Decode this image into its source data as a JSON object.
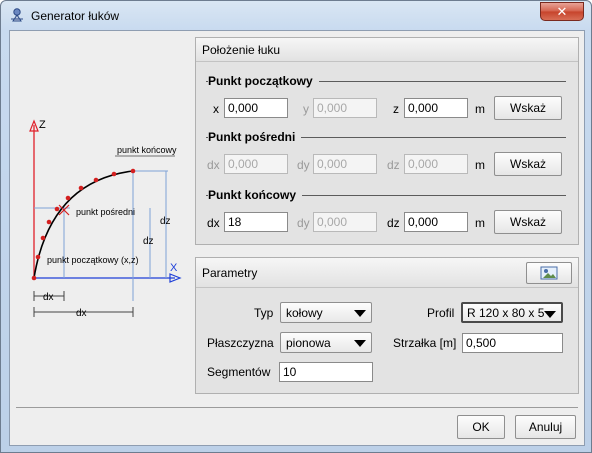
{
  "window": {
    "title": "Generator łuków",
    "close_symbol": "✕"
  },
  "diagram": {
    "axis_z": "Z",
    "axis_x": "X",
    "label_end": "punkt końcowy",
    "label_middle": "punkt pośredni",
    "label_start": "punkt początkowy (x,z)",
    "dim_dz_outer": "dz",
    "dim_dz_inner": "dz",
    "dim_dx_inner": "dx",
    "dim_dx_outer": "dx"
  },
  "position_panel": {
    "title": "Położenie łuku",
    "start": {
      "label": "Punkt początkowy",
      "c1_label": "x",
      "c1_value": "0,000",
      "c2_label": "y",
      "c2_value": "0,000",
      "c3_label": "z",
      "c3_value": "0,000",
      "unit": "m",
      "button": "Wskaż"
    },
    "middle": {
      "label": "Punkt pośredni",
      "c1_label": "dx",
      "c1_value": "0,000",
      "c2_label": "dy",
      "c2_value": "0,000",
      "c3_label": "dz",
      "c3_value": "0,000",
      "unit": "m",
      "button": "Wskaż"
    },
    "end": {
      "label": "Punkt końcowy",
      "c1_label": "dx",
      "c1_value": "18",
      "c2_label": "dy",
      "c2_value": "0,000",
      "c3_label": "dz",
      "c3_value": "0,000",
      "unit": "m",
      "button": "Wskaż"
    }
  },
  "params_panel": {
    "title": "Parametry",
    "type_label": "Typ",
    "type_value": "kołowy",
    "profile_label": "Profil",
    "profile_value": "R 120 x 80 x 5",
    "plane_label": "Płaszczyzna",
    "plane_value": "pionowa",
    "sag_label": "Strzałka [m]",
    "sag_value": "0,500",
    "segments_label": "Segmentów",
    "segments_value": "10"
  },
  "footer": {
    "ok": "OK",
    "cancel": "Anuluj"
  },
  "colors": {
    "axis": "#e0202a",
    "axis_x": "#1e3fd8",
    "curve": "#000000",
    "point": "#d42020"
  },
  "icons": {
    "app": "pin-icon",
    "profile_picker": "image-icon"
  }
}
